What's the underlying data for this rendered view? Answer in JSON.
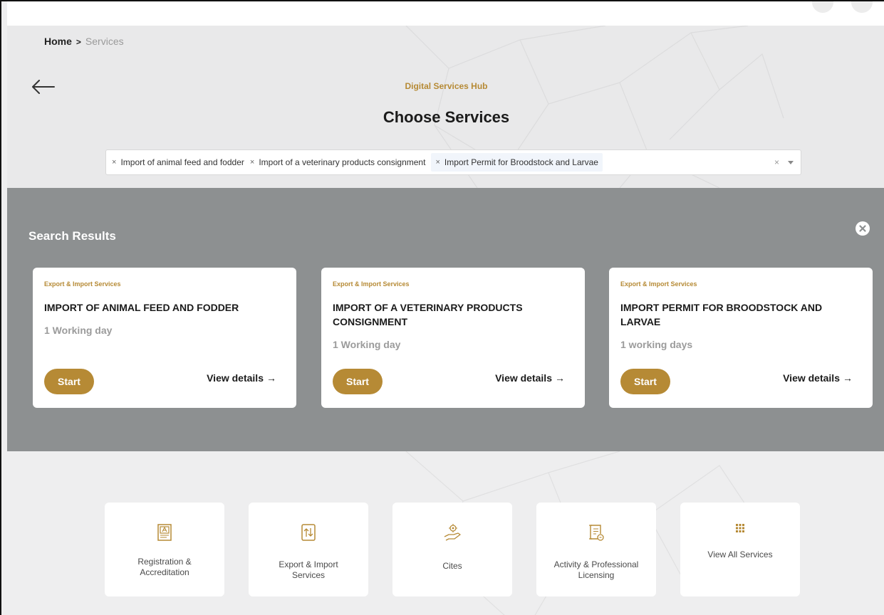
{
  "breadcrumb": {
    "home": "Home",
    "separator": ">",
    "current": "Services"
  },
  "header": {
    "eyebrow": "Digital Services Hub",
    "title": "Choose Services"
  },
  "service_select": {
    "selected": [
      "Import of animal feed and fodder",
      "Import of a veterinary products consignment",
      "Import Permit for Broodstock and Larvae"
    ],
    "remove_glyph": "×",
    "clear_glyph": "×"
  },
  "results": {
    "title": "Search Results",
    "cards": [
      {
        "category": "Export & Import Services",
        "name": "IMPORT OF ANIMAL FEED AND FODDER",
        "duration": "1 Working day",
        "start": "Start",
        "details": "View details"
      },
      {
        "category": "Export & Import Services",
        "name": "IMPORT OF A VETERINARY PRODUCTS CONSIGNMENT",
        "duration": "1 Working day",
        "start": "Start",
        "details": "View details"
      },
      {
        "category": "Export & Import Services",
        "name": "IMPORT PERMIT FOR BROODSTOCK AND LARVAE",
        "duration": "1 working days",
        "start": "Start",
        "details": "View details"
      }
    ]
  },
  "categories": [
    {
      "label_1": "Registration &",
      "label_2": "Accreditation",
      "icon": "registration-icon"
    },
    {
      "label_1": "Export & Import",
      "label_2": "Services",
      "icon": "export-import-icon"
    },
    {
      "label_1": "Cites",
      "label_2": "",
      "icon": "cites-icon"
    },
    {
      "label_1": "Activity & Professional",
      "label_2": "Licensing",
      "icon": "licensing-icon"
    },
    {
      "label_1": "View All Services",
      "label_2": "",
      "icon": "grid-icon"
    }
  ],
  "colors": {
    "accent": "#b68a35",
    "results_bg": "#8d9091",
    "page_bg": "#eeeeef"
  }
}
